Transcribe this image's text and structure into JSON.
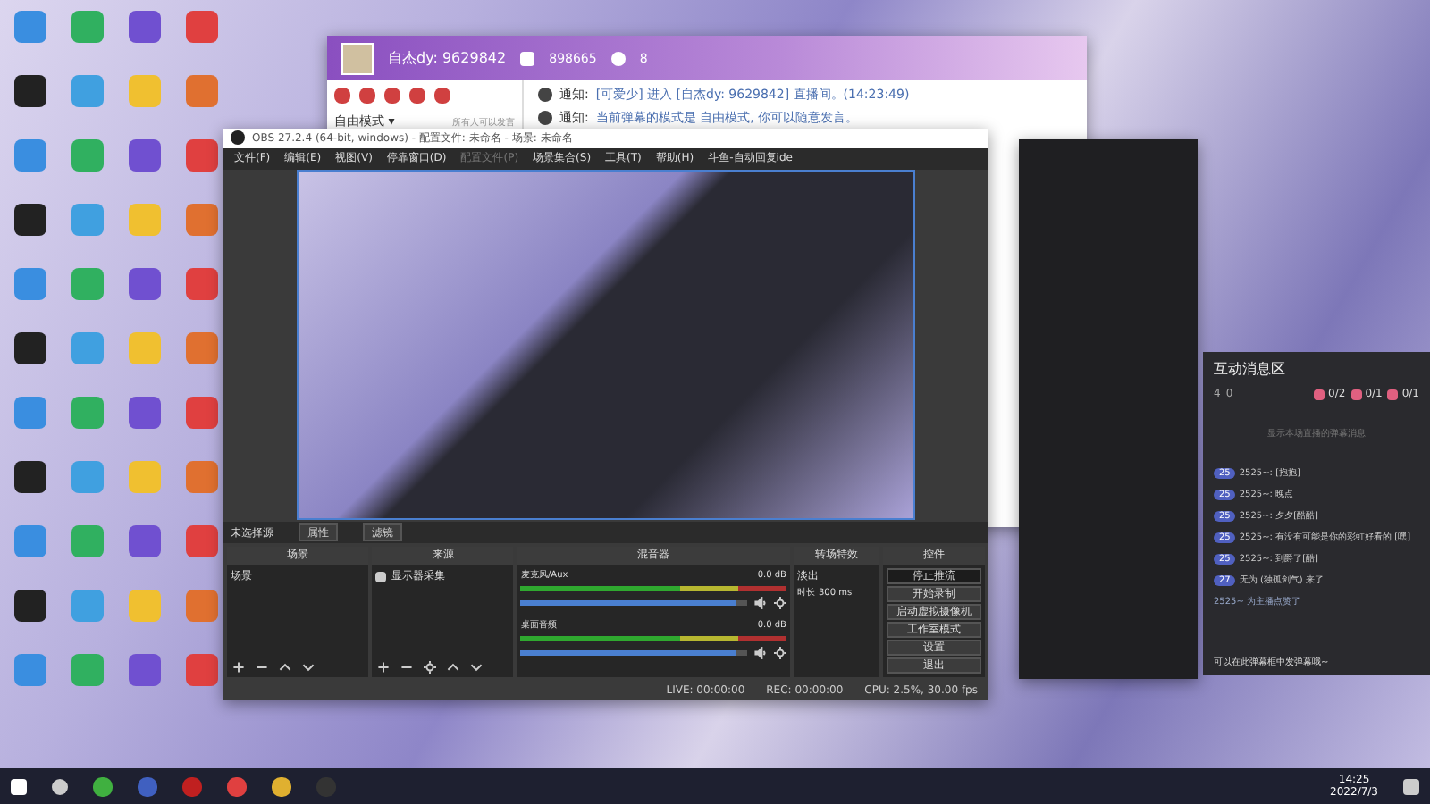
{
  "chat_window": {
    "streamer": "自杰dy: 9629842",
    "followers": "898665",
    "viewers": "8",
    "mode": "自由模式 ▾",
    "mode_note": "所有人可以发言",
    "messages": [
      {
        "label": "通知:",
        "text": "[可爱少] 进入 [自杰dy: 9629842] 直播间。(14:23:49)"
      },
      {
        "label": "通知:",
        "text": "当前弹幕的模式是 自由模式, 你可以随意发言。"
      }
    ]
  },
  "obs": {
    "title": "OBS 27.2.4 (64-bit, windows) - 配置文件: 未命名 - 场景: 未命名",
    "menu": [
      {
        "label": "文件(F)",
        "disabled": false
      },
      {
        "label": "编辑(E)",
        "disabled": false
      },
      {
        "label": "视图(V)",
        "disabled": false
      },
      {
        "label": "停靠窗口(D)",
        "disabled": false
      },
      {
        "label": "配置文件(P)",
        "disabled": true
      },
      {
        "label": "场景集合(S)",
        "disabled": false
      },
      {
        "label": "工具(T)",
        "disabled": false
      },
      {
        "label": "帮助(H)",
        "disabled": false
      },
      {
        "label": "斗鱼-自动回复ide",
        "disabled": false
      }
    ],
    "source_label": "未选择源",
    "source_buttons": [
      "属性",
      "滤镜"
    ],
    "scenes": {
      "title": "场景",
      "items": [
        "场景"
      ]
    },
    "sources": {
      "title": "来源",
      "items": [
        "显示器采集"
      ]
    },
    "mixer": {
      "title": "混音器",
      "channels": [
        {
          "name": "麦克风/Aux",
          "reading": "0.0 dB",
          "level": 0.95
        },
        {
          "name": "桌面音频",
          "reading": "0.0 dB",
          "level": 0.95
        }
      ]
    },
    "transitions": {
      "title": "转场特效",
      "type": "淡出",
      "duration_label": "时长",
      "duration": "300 ms"
    },
    "controls": {
      "title": "控件",
      "buttons": [
        {
          "label": "停止推流",
          "active": true
        },
        {
          "label": "开始录制",
          "active": false
        },
        {
          "label": "启动虚拟摄像机",
          "active": false
        },
        {
          "label": "工作室模式",
          "active": false
        },
        {
          "label": "设置",
          "active": false
        },
        {
          "label": "退出",
          "active": false
        }
      ]
    },
    "status": {
      "live": "LIVE: 00:00:00",
      "rec": "REC: 00:00:00",
      "cpu": "CPU: 2.5%, 30.00 fps"
    }
  },
  "interaction_panel": {
    "title": "互动消息区",
    "viewers": "4",
    "count": "0",
    "gifts": [
      "0/2",
      "0/1",
      "0/1"
    ],
    "empty_note": "显示本场直播的弹幕消息",
    "messages": [
      {
        "level": "25",
        "text": "2525~: [抱抱]"
      },
      {
        "level": "25",
        "text": "2525~: 晚点"
      },
      {
        "level": "25",
        "text": "2525~: 夕夕[酷酷]"
      },
      {
        "level": "25",
        "text": "2525~: 有没有可能是你的彩虹好看的 [嘿]"
      },
      {
        "level": "25",
        "text": "2525~: 到爵了[酷]"
      },
      {
        "level": "27",
        "text": "无为 (独孤剑气) 来了"
      }
    ],
    "like_note": "2525~ 为主播点赞了",
    "input_hint": "可以在此弹幕框中发弹幕哦~"
  },
  "taskbar": {
    "time": "14:25",
    "date": "2022/7/3"
  }
}
